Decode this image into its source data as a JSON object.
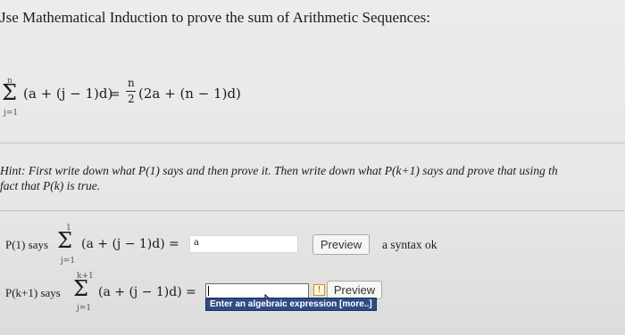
{
  "title": "Jse Mathematical Induction to prove the sum of Arithmetic Sequences:",
  "formula": {
    "sum_top": "n",
    "sum_bottom": "j=1",
    "lhs": "(a + (j − 1)d)",
    "equals": "=",
    "frac_num": "n",
    "frac_den": "2",
    "rhs": "(2a + (n − 1)d)"
  },
  "hint": {
    "line1": "Hint: First write down what P(1) says and then prove it. Then write down what P(k+1) says and prove that using th",
    "line2": "fact that P(k) is true."
  },
  "p1": {
    "label": "P(1) says",
    "sum_top": "1",
    "sum_bottom": "j=1",
    "expr": "(a + (j − 1)d)",
    "equals": "=",
    "answer": "a",
    "preview_label": "Preview",
    "status": "a syntax ok"
  },
  "pk1": {
    "label": "P(k+1) says",
    "sum_top": "k+1",
    "sum_bottom": "j=1",
    "expr": "(a + (j − 1)d)",
    "equals": "=",
    "answer": "",
    "indicator": "!",
    "preview_label": "Preview",
    "tooltip": "Enter an algebraic expression [more..]"
  }
}
